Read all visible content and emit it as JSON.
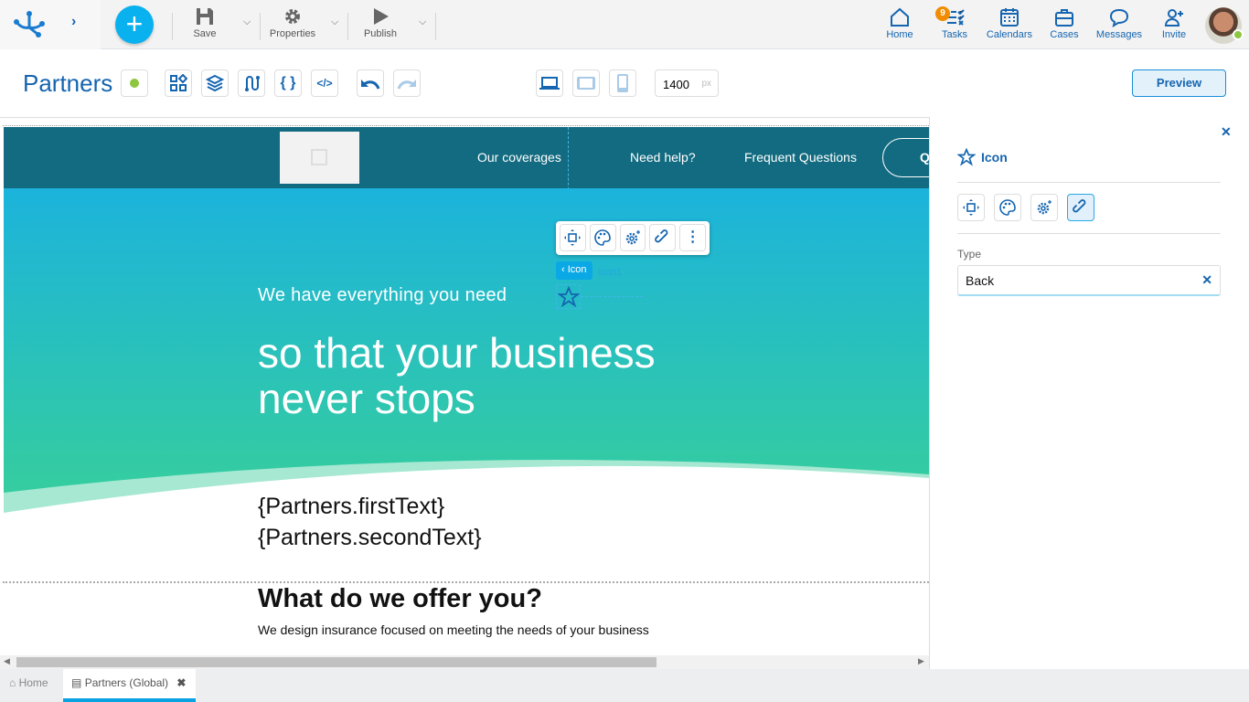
{
  "topbar": {
    "save": "Save",
    "properties": "Properties",
    "publish": "Publish",
    "nav": [
      {
        "label": "Home",
        "icon": "home-icon"
      },
      {
        "label": "Tasks",
        "icon": "tasks-icon",
        "badge": "9"
      },
      {
        "label": "Calendars",
        "icon": "calendar-icon"
      },
      {
        "label": "Cases",
        "icon": "briefcase-icon"
      },
      {
        "label": "Messages",
        "icon": "chat-icon"
      },
      {
        "label": "Invite",
        "icon": "add-user-icon"
      }
    ]
  },
  "toolbar": {
    "title": "Partners",
    "width_value": "1400",
    "width_unit": "px",
    "preview": "Preview"
  },
  "page": {
    "nav": [
      "Our coverages",
      "Need help?",
      "Frequent Questions"
    ],
    "nav_button": "Q",
    "subtitle": "We have everything you need",
    "headline1": "so that your business",
    "headline2": "never stops",
    "first_text": "{Partners.firstText}",
    "second_text": "{Partners.secondText}",
    "offer_title": "What do we offer you?",
    "offer_text": "We design insurance focused on meeting the needs of your business",
    "selected_tag": "Icon",
    "selected_name": "icon1"
  },
  "panel": {
    "title": "Icon",
    "type_label": "Type",
    "type_value": "Back"
  },
  "tabs": {
    "home": "Home",
    "partners": "Partners (Global)"
  },
  "colors": {
    "accent": "#0aa9e6",
    "brand_blue": "#1565b0",
    "header_teal": "#126b80",
    "status_green": "#8dc63f"
  }
}
